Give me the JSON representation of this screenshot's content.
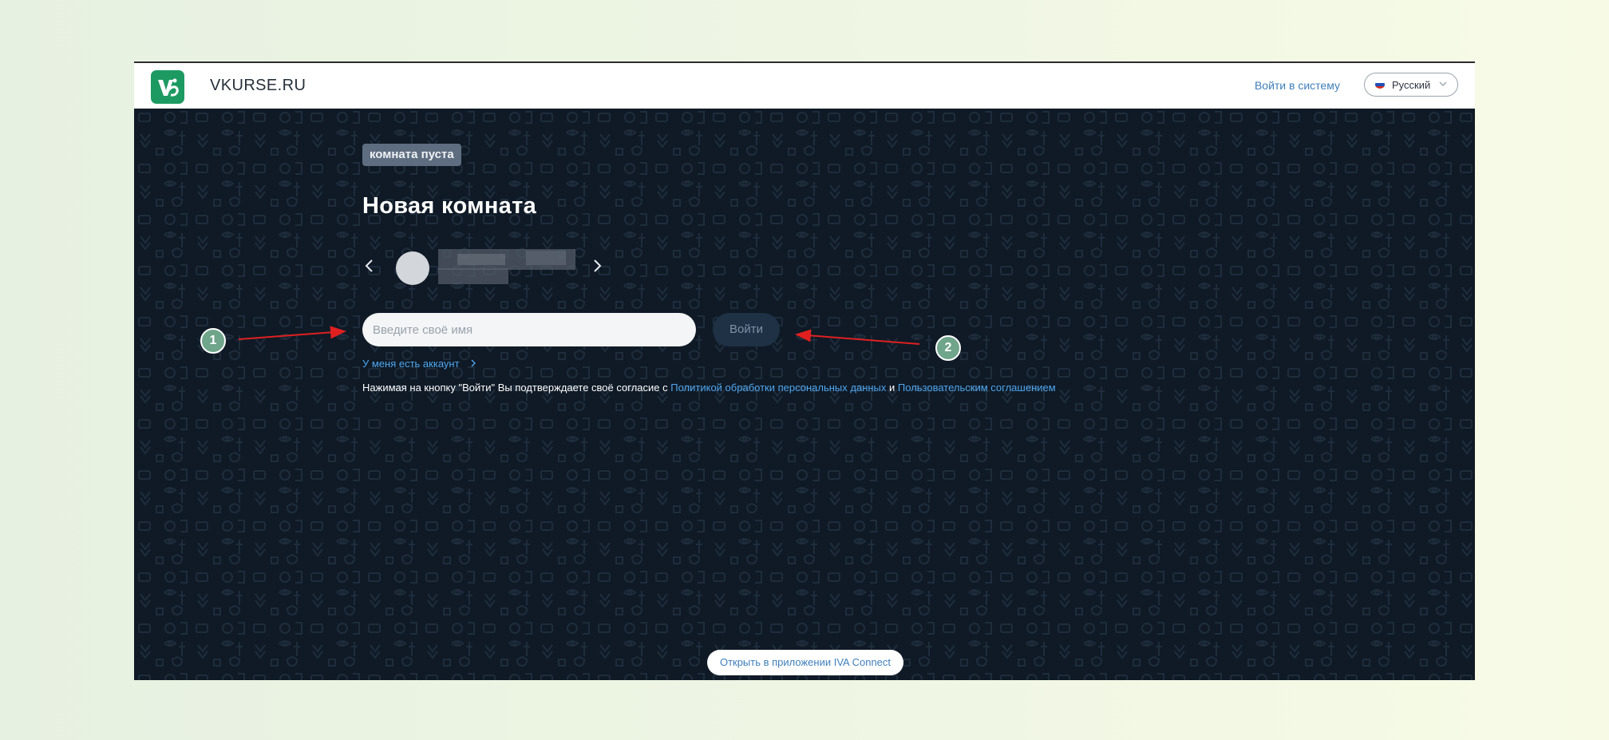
{
  "header": {
    "brand": "VKURSE.RU",
    "login_link": "Войти в систему",
    "language": "Русский"
  },
  "room": {
    "status_badge": "комната пуста",
    "title": "Новая комната"
  },
  "form": {
    "name_placeholder": "Введите своё имя",
    "enter_button": "Войти",
    "account_link": "У меня есть аккаунт"
  },
  "consent": {
    "prefix": "Нажимая на кнопку \"Войти\" Вы подтверждаете своё согласие с",
    "privacy_link": "Политикой обработки персональных данных",
    "conjunction": "и",
    "terms_link": "Пользовательским соглашением"
  },
  "footer": {
    "open_app_button": "Открыть в приложении IVA Connect"
  },
  "annotations": {
    "marker_1": "1",
    "marker_2": "2"
  },
  "colors": {
    "brand_green": "#1d9a62",
    "hero_background": "#0f1a26",
    "link_blue": "#4ea6ef",
    "annotation_marker": "#6fa58a",
    "annotation_arrow": "#e02020"
  },
  "icons": [
    "logo-icon",
    "russia-flag-icon",
    "chevron-down-icon",
    "chevron-left-icon",
    "chevron-right-icon",
    "avatar"
  ]
}
